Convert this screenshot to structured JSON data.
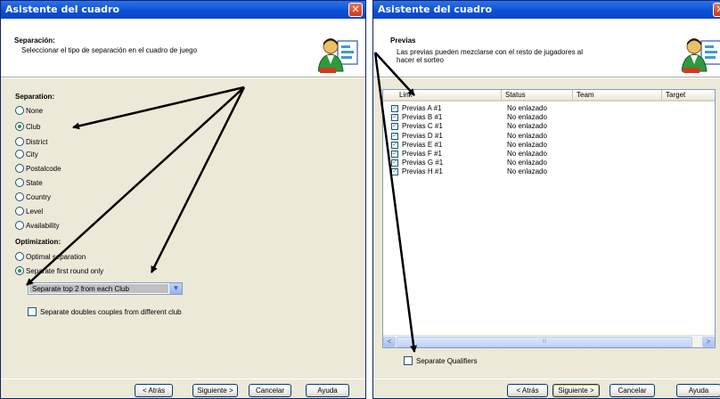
{
  "left_window": {
    "title": "Asistente del cuadro",
    "close_glyph": "✕",
    "header_title": "Separación:",
    "header_desc": "Seleccionar el tipo de separación en el cuadro de juego",
    "separation_label": "Separation:",
    "separation_options": [
      {
        "label": "None",
        "selected": false
      },
      {
        "label": "Club",
        "selected": true
      },
      {
        "label": "District",
        "selected": false
      },
      {
        "label": "City",
        "selected": false
      },
      {
        "label": "Postalcode",
        "selected": false
      },
      {
        "label": "State",
        "selected": false
      },
      {
        "label": "Country",
        "selected": false
      },
      {
        "label": "Level",
        "selected": false
      },
      {
        "label": "Availability",
        "selected": false
      }
    ],
    "optimization_label": "Optimization:",
    "optimization_options": [
      {
        "label": "Optimal separation",
        "selected": false
      },
      {
        "label": "Separate first round only",
        "selected": true
      }
    ],
    "dropdown_value": "Separate top 2 from each Club",
    "dropdown_glyph": "▼",
    "doubles_checkbox_label": "Separate doubles couples from different club",
    "buttons": {
      "back": "< Atrás",
      "next": "Siguiente >",
      "cancel": "Cancelar",
      "help": "Ayuda"
    }
  },
  "right_window": {
    "title": "Asistente del cuadro",
    "header_title": "Previas",
    "header_desc_line1": "Las previas pueden mezclarse con el resto de jugadores al",
    "header_desc_line2": "hacer el sorteo",
    "columns": [
      "Link",
      "Status",
      "Team",
      "Target"
    ],
    "rows": [
      {
        "link": "Previas A #1",
        "status": "No enlazado",
        "checked": true
      },
      {
        "link": "Previas B #1",
        "status": "No enlazado",
        "checked": true
      },
      {
        "link": "Previas C #1",
        "status": "No enlazado",
        "checked": true
      },
      {
        "link": "Previas D #1",
        "status": "No enlazado",
        "checked": true
      },
      {
        "link": "Previas E #1",
        "status": "No enlazado",
        "checked": true
      },
      {
        "link": "Previas F #1",
        "status": "No enlazado",
        "checked": true
      },
      {
        "link": "Previas G #1",
        "status": "No enlazado",
        "checked": true
      },
      {
        "link": "Previas H #1",
        "status": "No enlazado",
        "checked": true
      }
    ],
    "check_glyph": "✓",
    "scroll_left_glyph": "<",
    "scroll_right_glyph": ">",
    "scroll_thumb_glyph": "III",
    "qualifiers_checkbox_label": "Separate Qualifiers",
    "buttons": {
      "back": "< Atrás",
      "next": "Siguiente >",
      "cancel": "Cancelar",
      "help": "Ayuda"
    }
  },
  "colors": {
    "titlebar": "#0b51d6",
    "dialog_bg": "#ece9d8",
    "annotation_arrows": "#000000",
    "check_green": "#21a121"
  },
  "icons": {
    "header_logo": "users-wizard-icon",
    "annotation": "arrow-annotation"
  }
}
